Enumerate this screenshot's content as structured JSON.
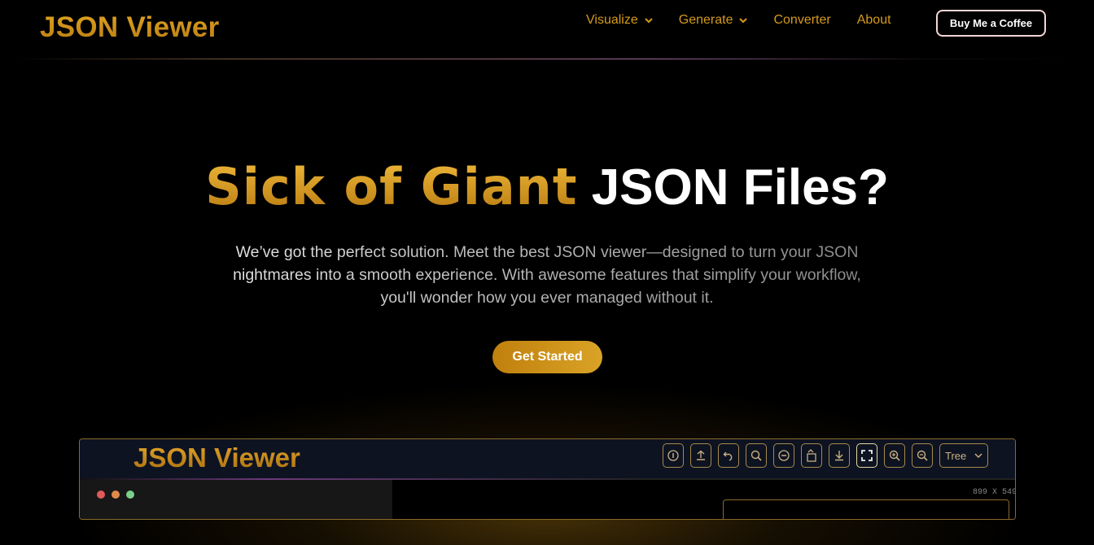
{
  "header": {
    "logo": "JSON Viewer",
    "nav": [
      {
        "label": "Visualize",
        "has_dropdown": true
      },
      {
        "label": "Generate",
        "has_dropdown": true
      },
      {
        "label": "Converter",
        "has_dropdown": false
      },
      {
        "label": "About",
        "has_dropdown": false
      }
    ],
    "cta": "Buy Me a Coffee"
  },
  "hero": {
    "title_highlight": "Sick of Giant",
    "title_rest": "JSON Files?",
    "subtitle": "We’ve got the perfect solution. Meet the best JSON viewer—designed to turn your JSON nightmares into a smooth experience. With awesome features that simplify your workflow, you'll wonder how you ever managed without it.",
    "button": "Get Started"
  },
  "preview": {
    "logo": "JSON Viewer",
    "tools": [
      "info-icon",
      "upload-icon",
      "undo-icon",
      "search-icon",
      "minus-circle-icon",
      "rotate-icon",
      "download-icon",
      "fullscreen-icon",
      "zoom-in-icon",
      "zoom-out-icon"
    ],
    "view_select": "Tree",
    "dimensions": "899 X 549",
    "window_dots": [
      "#e05a5a",
      "#e08a4a",
      "#7ad08a"
    ]
  },
  "colors": {
    "accent": "#d59a1a",
    "background": "#000000"
  }
}
